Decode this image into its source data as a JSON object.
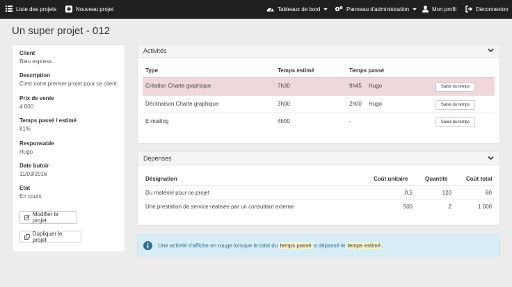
{
  "nav": {
    "projects_list": "Liste des projets",
    "new_project": "Nouveau projet",
    "dashboards": "Tableaux de bord",
    "admin_panel": "Panneau d'administration",
    "profile": "Mon profil",
    "logout": "Déconnexion"
  },
  "page": {
    "title": "Un super projet - 012"
  },
  "project": {
    "fields": [
      {
        "label": "Client",
        "value": "Bleu express"
      },
      {
        "label": "Description",
        "value": "C'est notre premier projet pour ce client."
      },
      {
        "label": "Prix de vente",
        "value": "4 800"
      },
      {
        "label": "Temps passé / estimé",
        "value": "81%"
      },
      {
        "label": "Responsable",
        "value": "Hugo"
      },
      {
        "label": "Date butoir",
        "value": "11/03/2016"
      },
      {
        "label": "Etat",
        "value": "En cours"
      }
    ],
    "edit_button": "Modifier le projet",
    "duplicate_button": "Dupliquer le projet"
  },
  "activities": {
    "title": "Activités",
    "headers": {
      "type": "Type",
      "estimated": "Temps estimé",
      "spent": "Temps passé"
    },
    "rows": [
      {
        "type": "Création Charte graphique",
        "estimated": "7h30",
        "spent": "9h45",
        "user": "Hugo",
        "action": "Saisir du temps",
        "status": "over"
      },
      {
        "type": "Déclinaison Charte graphique",
        "estimated": "3h00",
        "spent": "2h00",
        "user": "Hugo",
        "action": "Saisir du temps",
        "status": "ok"
      },
      {
        "type": "E-mailing",
        "estimated": "4h00",
        "spent": "-",
        "user": "",
        "action": "Saisir du temps",
        "status": "ok"
      }
    ]
  },
  "expenses": {
    "title": "Dépenses",
    "headers": {
      "designation": "Désignation",
      "unit_cost": "Coût unitaire",
      "quantity": "Quantité",
      "total_cost": "Coût total"
    },
    "rows": [
      {
        "designation": "Du matériel pour ce projet",
        "unit_cost": "0,5",
        "quantity": "120",
        "total_cost": "60"
      },
      {
        "designation": "Une prestation de service réalisée par un consultant externe",
        "unit_cost": "500",
        "quantity": "2",
        "total_cost": "1 000"
      }
    ]
  },
  "info": {
    "part1": "Une activité s'affiche en rouge lorsque le total du",
    "highlight1": "temps passé",
    "part2": "a dépassé le",
    "highlight2": "temps estimé",
    "part3": "."
  },
  "colors": {
    "topbar": "#202020",
    "danger_row": "#f0d8da",
    "info_bg": "#d9edf7",
    "info_text": "#31708f",
    "highlight": "#fcf8c9"
  }
}
